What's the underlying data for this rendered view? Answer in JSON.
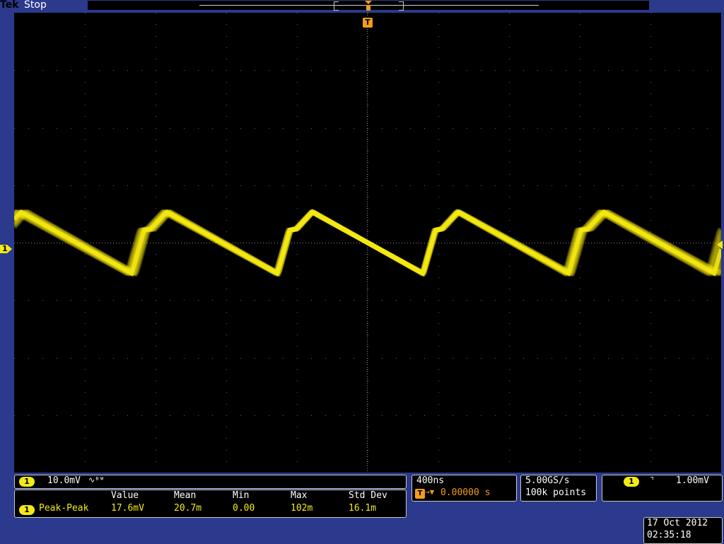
{
  "status_bar": {
    "brand": "Tek",
    "run_state": "Stop"
  },
  "trigger_marker": {
    "label": "T"
  },
  "channel_marker": {
    "label": "1"
  },
  "channel_panel": {
    "channel": "1",
    "scale": "10.0mV",
    "bandwidth_icon": "∿ᴮᵂ"
  },
  "measurements": {
    "headers": [
      "Value",
      "Mean",
      "Min",
      "Max",
      "Std Dev"
    ],
    "rows": [
      {
        "channel": "1",
        "name": "Peak-Peak",
        "values": [
          "17.6mV",
          "20.7m",
          "0.00",
          "102m",
          "16.1m"
        ]
      }
    ]
  },
  "horizontal": {
    "time_per_div": "400ns",
    "trigger_icon": "T",
    "position_arrow": "→▼",
    "position": "0.00000 s"
  },
  "acquisition": {
    "sample_rate": "5.00GS/s",
    "record_length": "100k points"
  },
  "trigger": {
    "source": "1",
    "slope_icon": "falling-edge-icon",
    "slope_glyph": "⌝",
    "level": "1.00mV"
  },
  "datetime": {
    "date": "17 Oct  2012",
    "time": "02:35:18"
  },
  "colors": {
    "background": "#2b3a8c",
    "screen": "#000000",
    "channel1": "#f3ea14",
    "trigger": "#f39c1a"
  },
  "waveform": {
    "channel": "1",
    "shape": "sawtooth",
    "period_divisions": 2.06,
    "amplitude_divisions": 1.07,
    "offset_divisions": 0,
    "persistence": true
  }
}
